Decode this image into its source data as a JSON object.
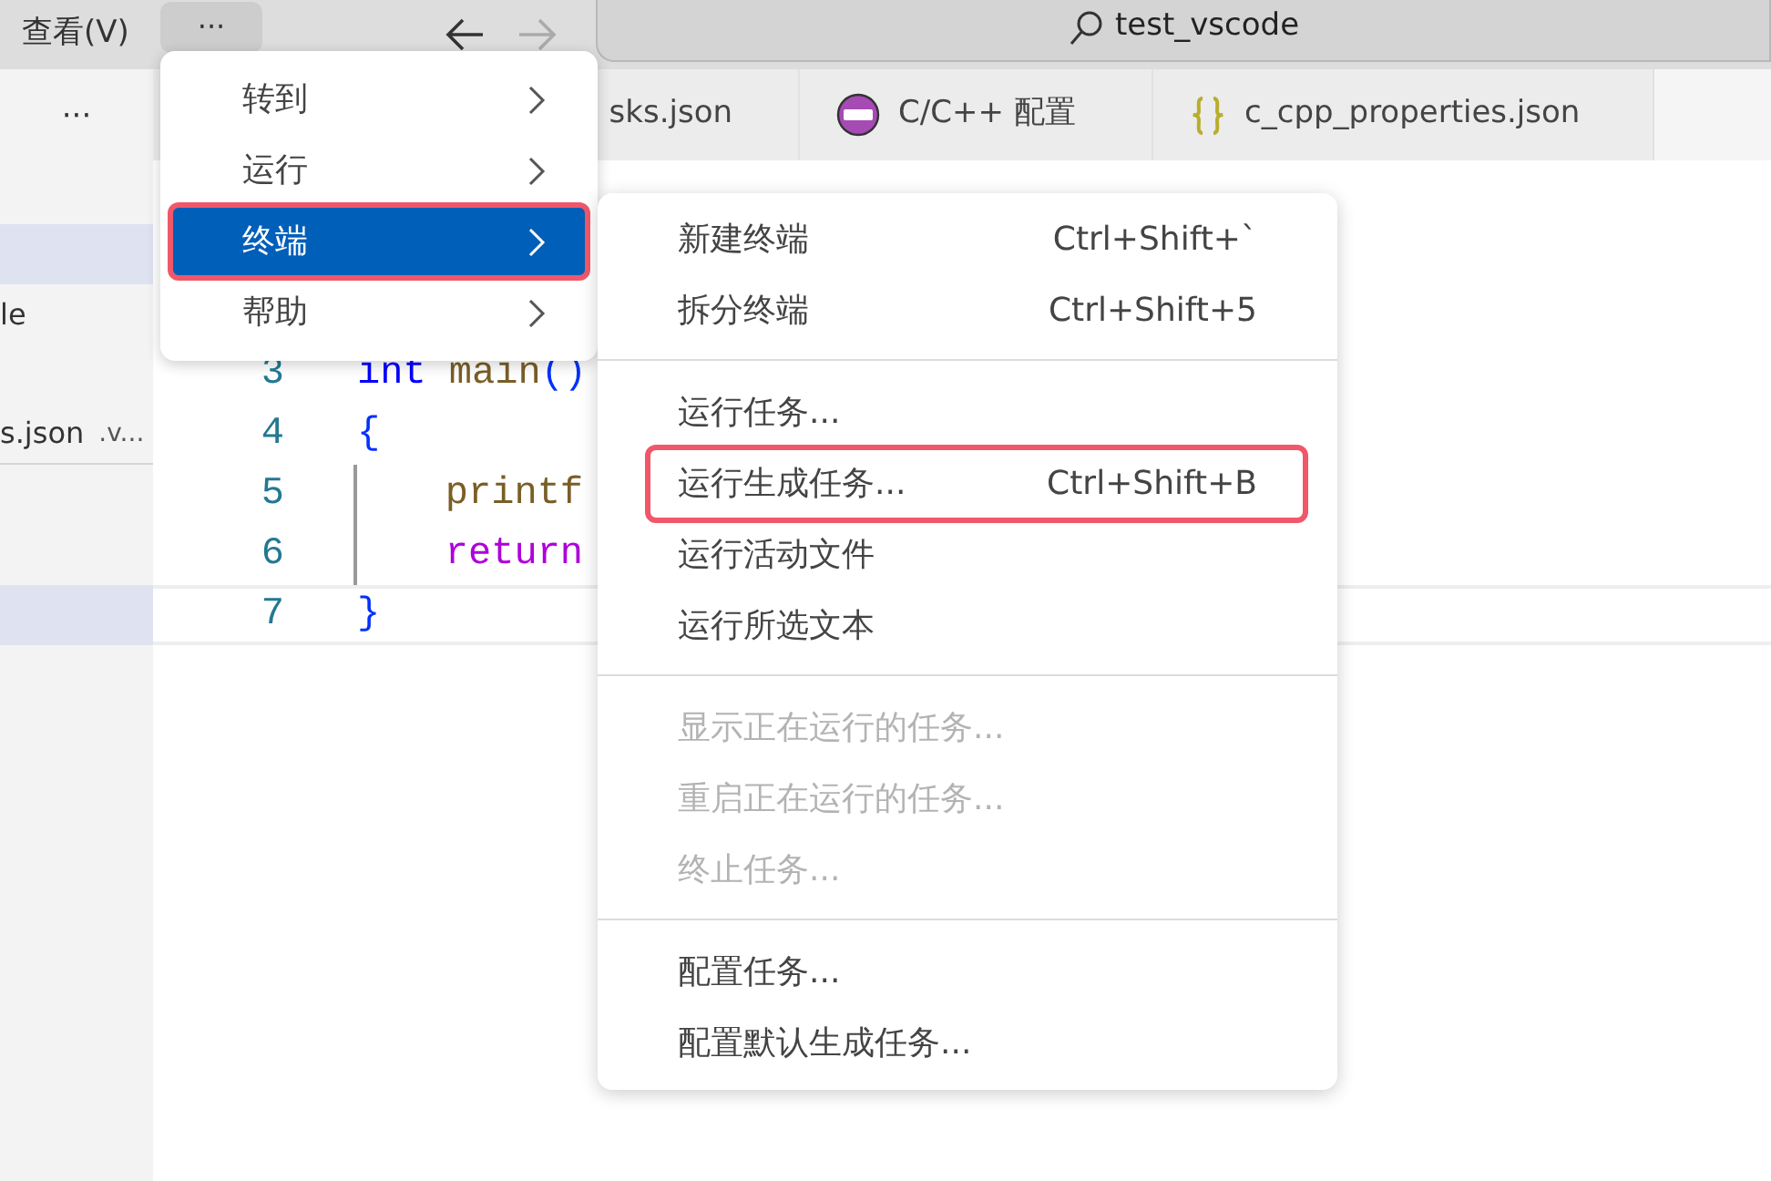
{
  "title_bar": {
    "menu_label": "查看(V)",
    "more_label": "···",
    "back_enabled": true,
    "forward_enabled": false,
    "search_text": "test_vscode"
  },
  "sidebar": {
    "more_label": "···",
    "sections": [
      {
        "rows": [
          {
            "selected": true
          },
          {
            "label": "le",
            "selected": false
          },
          {
            "label": "s.json",
            "description": ".v...",
            "selected": false
          }
        ]
      },
      {
        "rows": [
          {
            "selected": true
          }
        ]
      }
    ]
  },
  "tabs": [
    {
      "label": "sks.json",
      "kind": "plain"
    },
    {
      "label": "C/C++ 配置",
      "kind": "cpp"
    },
    {
      "label": "c_cpp_properties.json",
      "kind": "json"
    }
  ],
  "editor": {
    "lines": [
      {
        "number": "3",
        "tokens": [
          {
            "kind": "keyword",
            "text": "int"
          },
          {
            "kind": "function",
            "text": "main",
            "space_before": true
          },
          {
            "kind": "bracket",
            "text": "()"
          }
        ]
      },
      {
        "number": "4",
        "tokens": [
          {
            "kind": "bracket",
            "text": "{"
          }
        ]
      },
      {
        "number": "5",
        "indented": true,
        "tokens": [
          {
            "kind": "function",
            "text": "printf"
          }
        ]
      },
      {
        "number": "6",
        "indented": true,
        "tokens": [
          {
            "kind": "control",
            "text": "return"
          }
        ]
      },
      {
        "number": "7",
        "tokens": [
          {
            "kind": "bracket",
            "text": "}"
          }
        ],
        "current": true
      }
    ]
  },
  "main_menu": {
    "items": [
      {
        "label": "转到",
        "selected": false,
        "highlighted": false
      },
      {
        "label": "运行",
        "selected": false,
        "highlighted": false
      },
      {
        "label": "终端",
        "selected": true,
        "highlighted": true
      },
      {
        "label": "帮助",
        "selected": false,
        "highlighted": false
      }
    ]
  },
  "terminal_menu": {
    "groups": [
      [
        {
          "label": "新建终端",
          "shortcut": "Ctrl+Shift+`",
          "disabled": false,
          "highlighted": false
        },
        {
          "label": "拆分终端",
          "shortcut": "Ctrl+Shift+5",
          "disabled": false,
          "highlighted": false
        }
      ],
      [
        {
          "label": "运行任务...",
          "disabled": false,
          "highlighted": false
        },
        {
          "label": "运行生成任务...",
          "shortcut": "Ctrl+Shift+B",
          "disabled": false,
          "highlighted": true
        },
        {
          "label": "运行活动文件",
          "disabled": false,
          "highlighted": false
        },
        {
          "label": "运行所选文本",
          "disabled": false,
          "highlighted": false
        }
      ],
      [
        {
          "label": "显示正在运行的任务...",
          "disabled": true,
          "highlighted": false
        },
        {
          "label": "重启正在运行的任务...",
          "disabled": true,
          "highlighted": false
        },
        {
          "label": "终止任务...",
          "disabled": true,
          "highlighted": false
        }
      ],
      [
        {
          "label": "配置任务...",
          "disabled": false,
          "highlighted": false
        },
        {
          "label": "配置默认生成任务...",
          "disabled": false,
          "highlighted": false
        }
      ]
    ]
  }
}
